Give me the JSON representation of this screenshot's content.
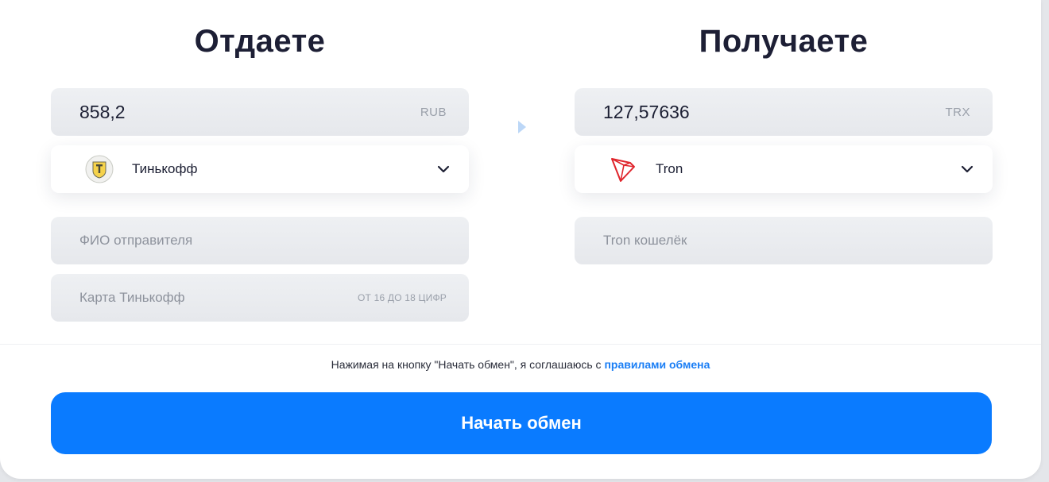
{
  "give": {
    "heading": "Отдаете",
    "amount": "858,2",
    "currency": "RUB",
    "method": {
      "name": "Тинькофф",
      "icon": "tinkoff-logo-icon"
    },
    "sender_name_placeholder": "ФИО отправителя",
    "card_placeholder": "Карта Тинькофф",
    "card_hint": "ОТ 16 ДО 18 ЦИФР"
  },
  "receive": {
    "heading": "Получаете",
    "amount": "127,57636",
    "currency": "TRX",
    "method": {
      "name": "Tron",
      "icon": "tron-logo-icon"
    },
    "wallet_placeholder": "Tron кошелёк"
  },
  "agreement": {
    "text": "Нажимая на кнопку \"Начать обмен\", я соглашаюсь с ",
    "link": "правилами обмена"
  },
  "submit_label": "Начать обмен",
  "colors": {
    "accent": "#0a7bff",
    "link": "#1a7ef5",
    "tron_red": "#e0262d",
    "tinkoff_yellow": "#f5d24b"
  }
}
